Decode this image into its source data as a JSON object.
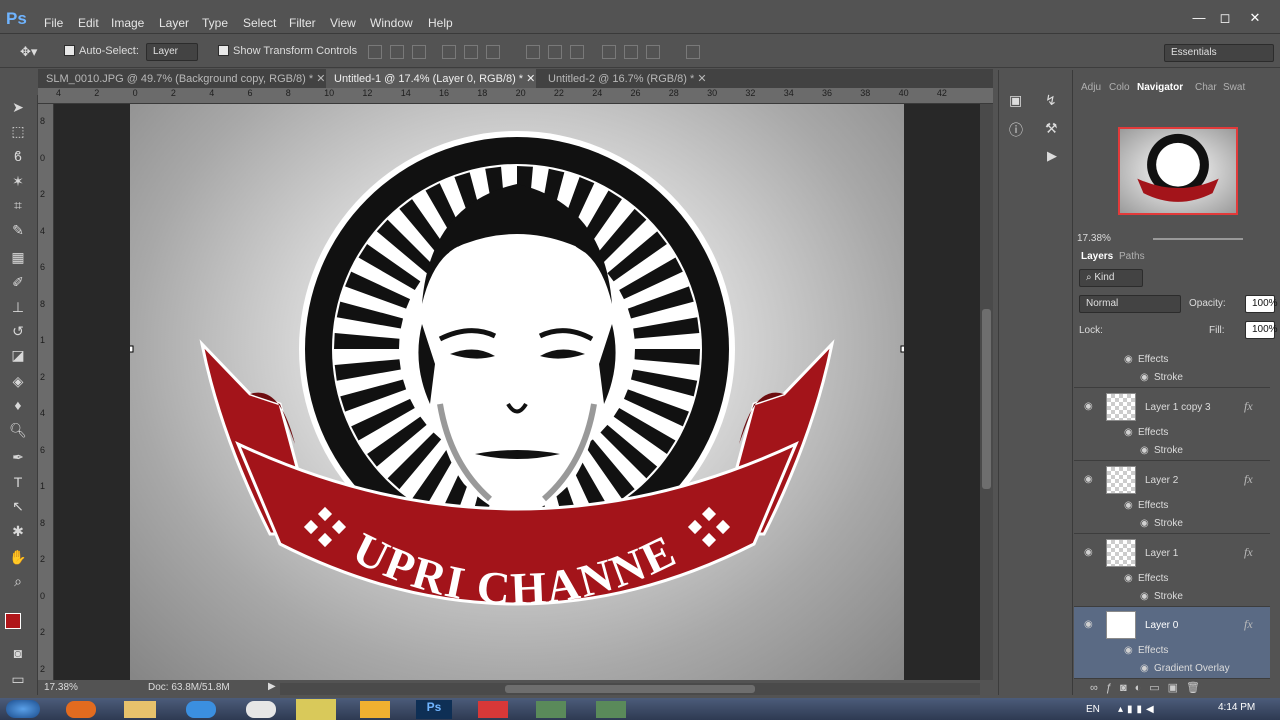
{
  "app": {
    "logo": "Ps",
    "window_controls": [
      "—",
      "◻",
      "✕"
    ]
  },
  "menu": [
    "File",
    "Edit",
    "Image",
    "Layer",
    "Type",
    "Select",
    "Filter",
    "View",
    "Window",
    "Help"
  ],
  "options": {
    "auto_select_label": "Auto-Select:",
    "auto_select_value": "Layer",
    "transform_label": "Show Transform Controls",
    "workspace": "Essentials"
  },
  "tabs": [
    {
      "label": "SLM_0010.JPG @ 49.7% (Background copy, RGB/8) *"
    },
    {
      "label": "Untitled-1 @ 17.4% (Layer 0, RGB/8) *"
    },
    {
      "label": "Untitled-2 @ 16.7% (RGB/8) *"
    }
  ],
  "ruler_h": [
    "4",
    "2",
    "0",
    "2",
    "4",
    "6",
    "8",
    "10",
    "12",
    "14",
    "16",
    "18",
    "20",
    "22",
    "24",
    "26",
    "28",
    "30",
    "32",
    "34",
    "36",
    "38",
    "40",
    "42"
  ],
  "ruler_v": [
    "8",
    "0",
    "2",
    "4",
    "6",
    "8",
    "1",
    "2",
    "4",
    "6",
    "1",
    "8",
    "2",
    "0",
    "2",
    "2"
  ],
  "status": {
    "zoom": "17.38%",
    "doc": "Doc: 63.8M/51.8M"
  },
  "logo_text": "SUPRI CHANNEL",
  "panels": {
    "top_tabs": [
      "Adju",
      "Colo",
      "Navigator",
      "Char",
      "Swat"
    ],
    "nav_zoom": "17.38%",
    "layer_tabs": [
      "Layers",
      "Paths"
    ],
    "kind": "Kind",
    "blend": "Normal",
    "opacity_label": "Opacity:",
    "opacity": "100%",
    "lock_label": "Lock:",
    "fill_label": "Fill:",
    "fill": "100%"
  },
  "layers_partial": {
    "effects": "Effects",
    "effect": "Stroke"
  },
  "layers": [
    {
      "name": "Layer 1 copy 3",
      "effects_label": "Effects",
      "effect": "Stroke"
    },
    {
      "name": "Layer 2",
      "effects_label": "Effects",
      "effect": "Stroke"
    },
    {
      "name": "Layer 1",
      "effects_label": "Effects",
      "effect": "Stroke"
    },
    {
      "name": "Layer 0",
      "effects_label": "Effects",
      "effect": "Gradient Overlay"
    }
  ],
  "taskbar": {
    "lang": "EN",
    "time": "4:14 PM"
  },
  "colors": {
    "foreground": "#b0161a",
    "ribbon": "#a3141a",
    "accent": "#6fb4ff"
  }
}
